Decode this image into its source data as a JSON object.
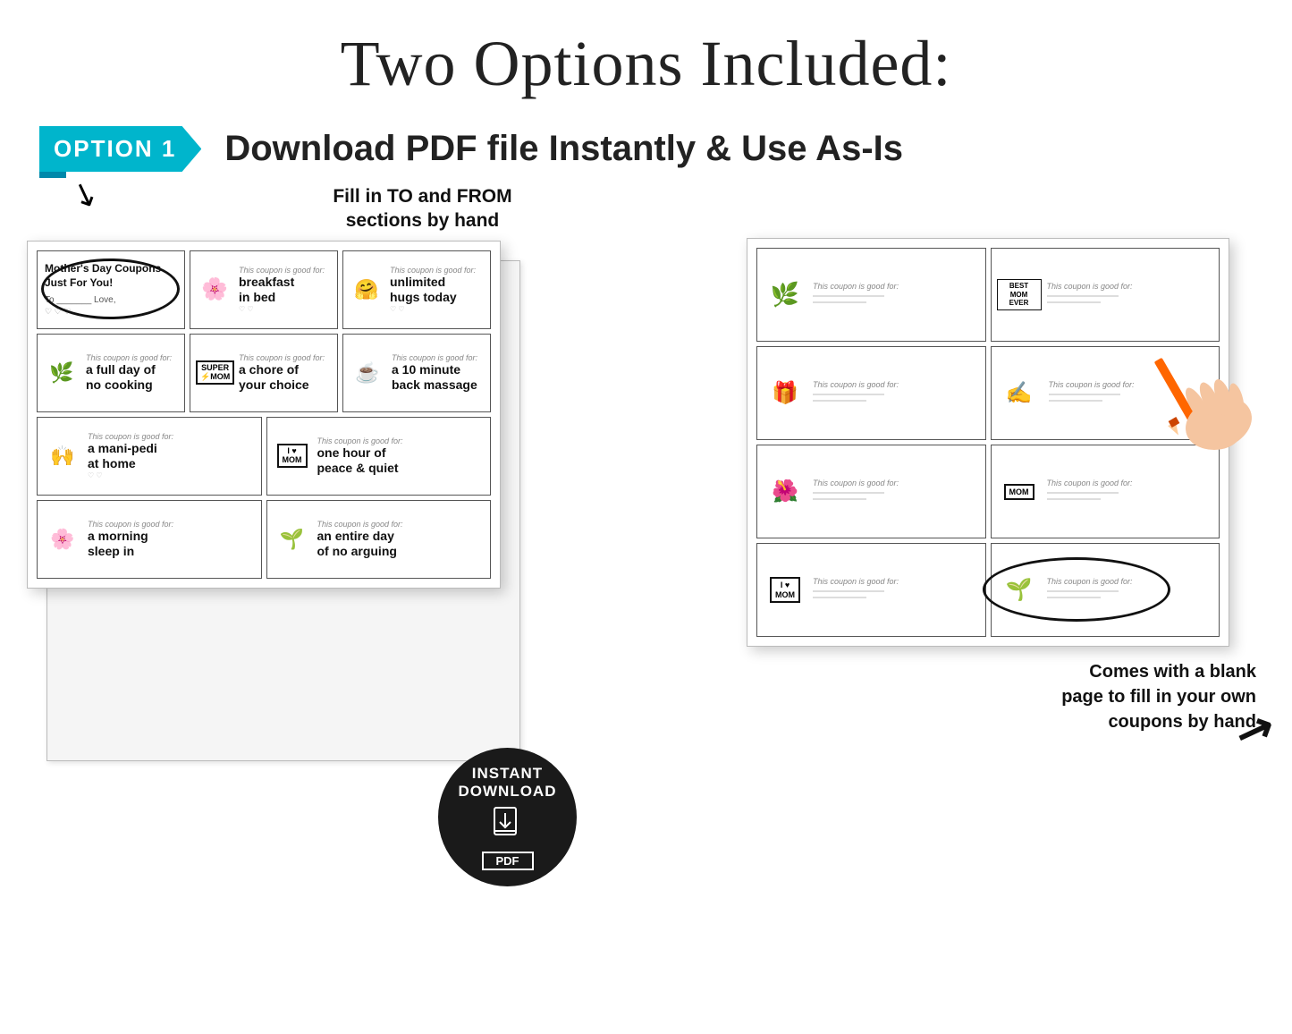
{
  "page": {
    "title": "Two Options Included:",
    "option_badge": "OPTION  1",
    "option_subtitle": "Download PDF file Instantly & Use As-Is",
    "fill_label_line1": "Fill in TO and FROM",
    "fill_label_line2": "sections by hand",
    "coupons": [
      {
        "icon_type": "title",
        "title": "Mother's Day Coupons Just For You!",
        "subtitle": "To          Love,"
      },
      {
        "icon_type": "mothers-day",
        "text_label": "This coupon is good for:",
        "text_value": "breakfast in bed"
      },
      {
        "icon_type": "unlimited-hugs",
        "text_label": "This coupon is good for:",
        "text_value": "unlimited hugs today"
      },
      {
        "icon_type": "heart-flower",
        "text_label": "This coupon is good for:",
        "text_value": "a full day of no cooking"
      },
      {
        "icon_type": "super-mom",
        "text_label": "This coupon is good for:",
        "text_value": "a chore of your choice"
      },
      {
        "icon_type": "back-massage",
        "text_label": "This coupon is good for:",
        "text_value": "a 10 minute back massage"
      },
      {
        "icon_type": "hands-heart",
        "text_label": "This coupon is good for:",
        "text_value": "a mani-pedi at home"
      },
      {
        "icon_type": "i-love-mom-shirt",
        "text_label": "This coupon is good for:",
        "text_value": "one hour of peace & quiet"
      },
      {
        "icon_type": "flowers-mug",
        "text_label": "This coupon is good for:",
        "text_value": "a morning sleep in"
      },
      {
        "icon_type": "plant-pot",
        "text_label": "This coupon is good for:",
        "text_value": "an entire day of no arguing"
      }
    ],
    "blank_coupons": [
      {
        "icon_type": "plant-sketch",
        "text_label": "This coupon is good for:"
      },
      {
        "icon_type": "best-mom-card",
        "text_label": "This coupon is good for:"
      },
      {
        "icon_type": "gift-mom",
        "text_label": "This coupon is good for:"
      },
      {
        "icon_type": "handwriting",
        "text_label": "This coupon is good for:"
      },
      {
        "icon_type": "vase-flowers",
        "text_label": "This coupon is good for:"
      },
      {
        "icon_type": "mom-sign2",
        "text_label": "This coupon is good for:"
      },
      {
        "icon_type": "i-love-mom-shirt2",
        "text_label": "This coupon is good for:"
      },
      {
        "icon_type": "flower-pot",
        "text_label": "This coupon is good for:"
      }
    ],
    "instant_download": {
      "line1": "INSTANT",
      "line2": "DOWNLOAD",
      "file_type": "PDF"
    },
    "bottom_note": "Comes with a blank\npage to fill in your own\ncoupons by hand"
  }
}
